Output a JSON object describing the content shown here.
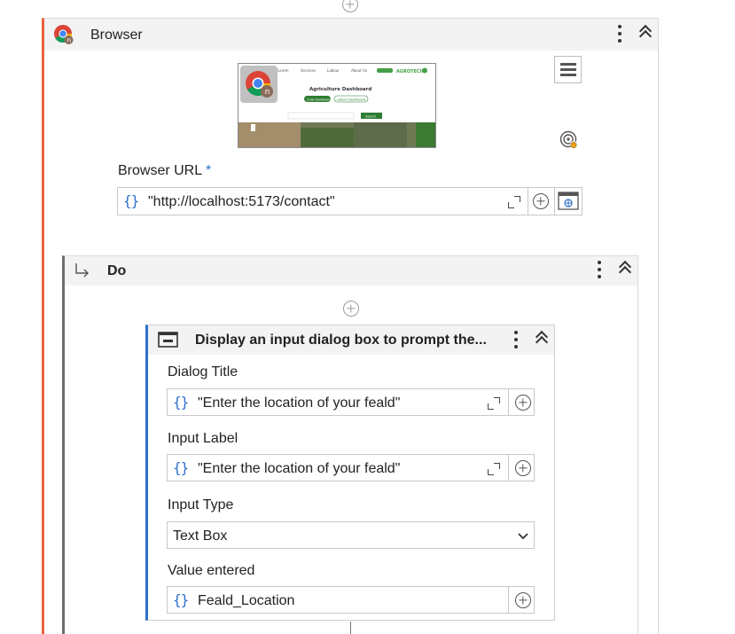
{
  "browser_activity": {
    "title": "Browser",
    "url_label": "Browser URL",
    "required_mark": "*",
    "url_value": "\"http://localhost:5173/contact\"",
    "brace": "{}",
    "thumbnail": {
      "nav_items": [
        "Lorem",
        "Services",
        "Labour",
        "About Us"
      ],
      "page_title": "Agriculture Dashboard",
      "button_1": "Crop Dashboard",
      "button_2": "Labour Dashboard",
      "search_btn": "Search",
      "brand": "AGROTECH"
    }
  },
  "do_block": {
    "title": "Do"
  },
  "dialog_activity": {
    "title": "Display an input dialog box to prompt the...",
    "fields": {
      "dialog_title_label": "Dialog Title",
      "dialog_title_value": "\"Enter the location of your feald\"",
      "input_label_label": "Input Label",
      "input_label_value": "\"Enter the location of your feald\"",
      "input_type_label": "Input Type",
      "input_type_value": "Text Box",
      "value_entered_label": "Value entered",
      "value_entered_value": "Feald_Location"
    }
  },
  "colors": {
    "browser_accent": "#e8633c",
    "do_accent": "#6d6d6d",
    "dialog_accent": "#2f6fca",
    "brace_color": "#2f6fca"
  }
}
